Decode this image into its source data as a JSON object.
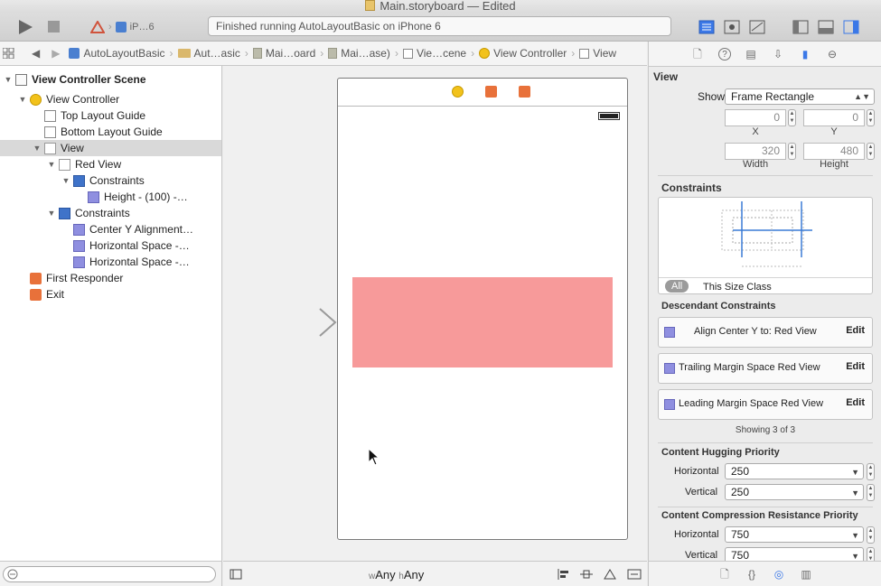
{
  "window": {
    "title": "Main.storyboard — Edited"
  },
  "toolbar": {
    "scheme_device": "iP…6",
    "status": "Finished running AutoLayoutBasic on iPhone 6"
  },
  "jumpbar": {
    "crumbs": [
      "AutoLayoutBasic",
      "Aut…asic",
      "Mai…oard",
      "Mai…ase)",
      "Vie…cene",
      "View Controller",
      "View"
    ]
  },
  "navigator": {
    "rows": [
      {
        "label": "View Controller Scene",
        "bold": true
      },
      {
        "label": "View Controller"
      },
      {
        "label": "Top Layout Guide"
      },
      {
        "label": "Bottom Layout Guide"
      },
      {
        "label": "View",
        "selected": true
      },
      {
        "label": "Red View"
      },
      {
        "label": "Constraints"
      },
      {
        "label": "Height - (100) -…"
      },
      {
        "label": "Constraints"
      },
      {
        "label": "Center Y Alignment…"
      },
      {
        "label": "Horizontal Space -…"
      },
      {
        "label": "Horizontal Space -…"
      },
      {
        "label": "First Responder"
      },
      {
        "label": "Exit"
      }
    ]
  },
  "canvas": {
    "size_class_w_prefix": "w",
    "size_class_w": "Any",
    "size_class_h_prefix": "h",
    "size_class_h": "Any",
    "red_view_color": "#f79a9a"
  },
  "inspector": {
    "section_view": "View",
    "show_label": "Show",
    "show_value": "Frame Rectangle",
    "x_value": "0",
    "y_value": "0",
    "x_label": "X",
    "y_label": "Y",
    "width_value": "320",
    "height_value": "480",
    "width_label": "Width",
    "height_label": "Height",
    "constraints_title": "Constraints",
    "all_pill": "All",
    "size_class_label": "This Size Class",
    "descendant_title": "Descendant Constraints",
    "descendant": [
      {
        "text": "Align Center Y to:  Red View",
        "edit": "Edit"
      },
      {
        "text": "Trailing Margin Space  Red View",
        "edit": "Edit"
      },
      {
        "text": "Leading Margin Space  Red View",
        "edit": "Edit"
      }
    ],
    "showing": "Showing 3 of 3",
    "hugging_title": "Content Hugging Priority",
    "hug_h_label": "Horizontal",
    "hug_h_value": "250",
    "hug_v_label": "Vertical",
    "hug_v_value": "250",
    "compression_title": "Content Compression Resistance Priority",
    "comp_h_label": "Horizontal",
    "comp_h_value": "750",
    "comp_v_label": "Vertical",
    "comp_v_value": "750"
  }
}
